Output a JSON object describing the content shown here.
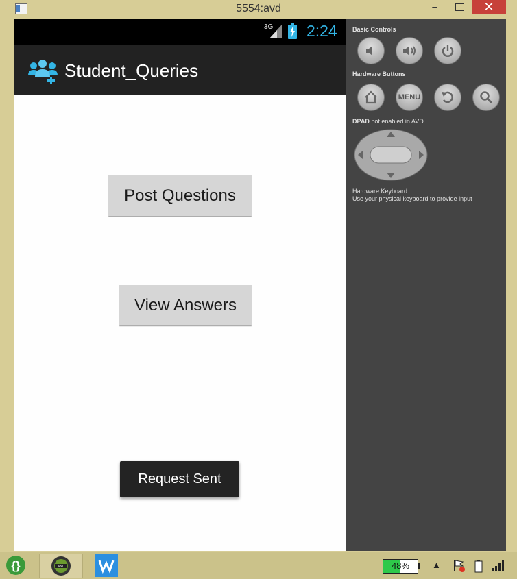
{
  "window": {
    "title": "5554:avd",
    "minimize_glyph": "–",
    "close_glyph": "✕"
  },
  "status_bar": {
    "network": "3G",
    "time": "2:24",
    "accent": "#33b5e5"
  },
  "action_bar": {
    "app_icon": "people-add-icon",
    "title": "Student_Queries"
  },
  "main": {
    "post_button": "Post Questions",
    "view_button": "View Answers",
    "toast": "Request Sent"
  },
  "controls": {
    "basic_label": "Basic Controls",
    "hardware_label": "Hardware Buttons",
    "menu_label": "MENU",
    "dpad_label_bold": "DPAD",
    "dpad_label_rest": " not enabled in AVD",
    "keyboard_label": "Hardware Keyboard",
    "keyboard_hint": "Use your physical keyboard to provide input",
    "buttons": [
      "volume-down-icon",
      "volume-up-icon",
      "power-icon",
      "home-icon",
      "menu-icon",
      "back-icon",
      "search-icon"
    ]
  },
  "taskbar": {
    "battery_percent": "48%",
    "battery_level": 0.48,
    "apps": [
      "brackets-app-icon",
      "android-app-icon",
      "w-app-icon"
    ]
  }
}
